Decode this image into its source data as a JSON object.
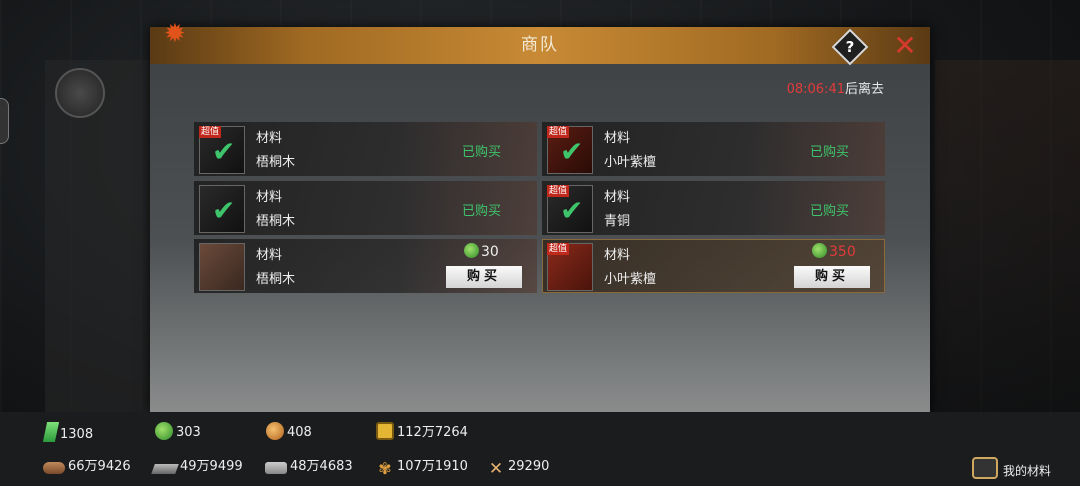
{
  "dialog": {
    "title": "商队",
    "help_label": "?",
    "close_label": "✕",
    "timer": "08:06:41",
    "timer_suffix": "后离去"
  },
  "items": [
    {
      "badge": "超值",
      "category": "材料",
      "name": "梧桐木",
      "status": "已购买",
      "icon": "check-icon"
    },
    {
      "badge": "超值",
      "category": "材料",
      "name": "小叶紫檀",
      "status": "已购买",
      "icon": "check-icon"
    },
    {
      "badge": "",
      "category": "材料",
      "name": "梧桐木",
      "status": "已购买",
      "icon": "check-icon"
    },
    {
      "badge": "超值",
      "category": "材料",
      "name": "青铜",
      "status": "已购买",
      "icon": "check-icon"
    },
    {
      "badge": "",
      "category": "材料",
      "name": "梧桐木",
      "price": "30",
      "price_color": "#eeeeee",
      "buy_label": "购买",
      "icon": "wood-logs-icon"
    },
    {
      "badge": "超值",
      "category": "材料",
      "name": "小叶紫檀",
      "price": "350",
      "price_color": "#e23b3b",
      "buy_label": "购买",
      "icon": "red-wood-icon"
    }
  ],
  "resources": {
    "jade": "1308",
    "green_coin": "303",
    "gold_coin": "408",
    "money": "112万7264",
    "wood": "66万9426",
    "iron": "49万9499",
    "stone": "48万4683",
    "grain": "107万1910",
    "troops": "29290"
  },
  "my_materials_label": "我的材料"
}
